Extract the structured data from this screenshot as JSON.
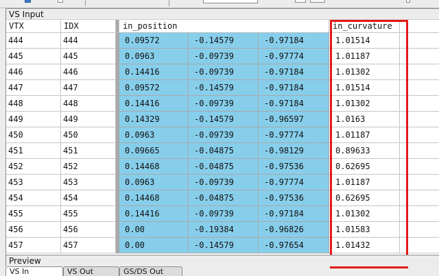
{
  "panel": {
    "title": "VS Input"
  },
  "columns": {
    "vtx": "VTX",
    "idx": "IDX",
    "position": "in_position",
    "curvature": "in_curvature"
  },
  "rows": [
    {
      "vtx": "444",
      "idx": "444",
      "px": "0.09572",
      "py": "-0.14579",
      "pz": "-0.97184",
      "curv": "1.01514"
    },
    {
      "vtx": "445",
      "idx": "445",
      "px": "0.0963",
      "py": "-0.09739",
      "pz": "-0.97774",
      "curv": "1.01187"
    },
    {
      "vtx": "446",
      "idx": "446",
      "px": "0.14416",
      "py": "-0.09739",
      "pz": "-0.97184",
      "curv": "1.01302"
    },
    {
      "vtx": "447",
      "idx": "447",
      "px": "0.09572",
      "py": "-0.14579",
      "pz": "-0.97184",
      "curv": "1.01514"
    },
    {
      "vtx": "448",
      "idx": "448",
      "px": "0.14416",
      "py": "-0.09739",
      "pz": "-0.97184",
      "curv": "1.01302"
    },
    {
      "vtx": "449",
      "idx": "449",
      "px": "0.14329",
      "py": "-0.14579",
      "pz": "-0.96597",
      "curv": "1.0163"
    },
    {
      "vtx": "450",
      "idx": "450",
      "px": "0.0963",
      "py": "-0.09739",
      "pz": "-0.97774",
      "curv": "1.01187"
    },
    {
      "vtx": "451",
      "idx": "451",
      "px": "0.09665",
      "py": "-0.04875",
      "pz": "-0.98129",
      "curv": "0.89633"
    },
    {
      "vtx": "452",
      "idx": "452",
      "px": "0.14468",
      "py": "-0.04875",
      "pz": "-0.97536",
      "curv": "0.62695"
    },
    {
      "vtx": "453",
      "idx": "453",
      "px": "0.0963",
      "py": "-0.09739",
      "pz": "-0.97774",
      "curv": "1.01187"
    },
    {
      "vtx": "454",
      "idx": "454",
      "px": "0.14468",
      "py": "-0.04875",
      "pz": "-0.97536",
      "curv": "0.62695"
    },
    {
      "vtx": "455",
      "idx": "455",
      "px": "0.14416",
      "py": "-0.09739",
      "pz": "-0.97184",
      "curv": "1.01302"
    },
    {
      "vtx": "456",
      "idx": "456",
      "px": "0.00",
      "py": "-0.19384",
      "pz": "-0.96826",
      "curv": "1.01583"
    },
    {
      "vtx": "457",
      "idx": "457",
      "px": "0.00",
      "py": "-0.14579",
      "pz": "-0.97654",
      "curv": "1.01432"
    }
  ],
  "preview": {
    "title": "Preview"
  },
  "tabs": [
    {
      "label": "VS In",
      "active": true
    },
    {
      "label": "VS Out",
      "active": false
    },
    {
      "label": "GS/DS Out",
      "active": false
    }
  ],
  "colors": {
    "position_fill": "#87ceeb",
    "highlight": "#e31818"
  }
}
